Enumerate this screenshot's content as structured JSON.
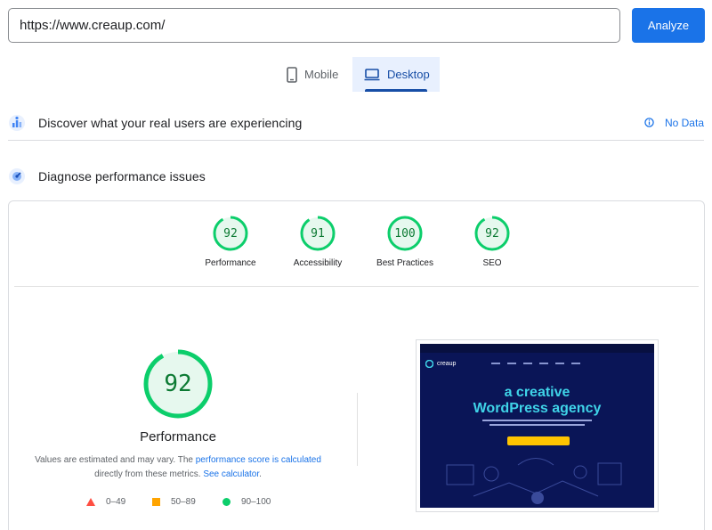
{
  "url_bar": {
    "value": "https://www.creaup.com/"
  },
  "analyze_button": {
    "label": "Analyze"
  },
  "device_tabs": {
    "mobile": "Mobile",
    "desktop": "Desktop",
    "selected": "Desktop"
  },
  "discover": {
    "title": "Discover what your real users are experiencing",
    "status": "No Data"
  },
  "diagnose": {
    "title": "Diagnose performance issues"
  },
  "scores": [
    {
      "label": "Performance",
      "value": "92"
    },
    {
      "label": "Accessibility",
      "value": "91"
    },
    {
      "label": "Best Practices",
      "value": "100"
    },
    {
      "label": "SEO",
      "value": "92"
    }
  ],
  "performance": {
    "score": "92",
    "title": "Performance",
    "desc_1": "Values are estimated and may vary. The ",
    "desc_link_1": "performance score is calculated",
    "desc_2": " directly from these metrics. ",
    "desc_link_2": "See calculator",
    "desc_3": "."
  },
  "legend": [
    {
      "range": "0–49",
      "color": "#ff4e42"
    },
    {
      "range": "50–89",
      "color": "#ffa400"
    },
    {
      "range": "90–100",
      "color": "#0cce6b"
    }
  ],
  "colors": {
    "accent": "#1a73e8",
    "pass": "#0cce6b",
    "pass_text": "#0c7a33"
  },
  "screenshot": {
    "headline_1": "a creative",
    "headline_2": "WordPress agency",
    "logo": "creaup"
  }
}
